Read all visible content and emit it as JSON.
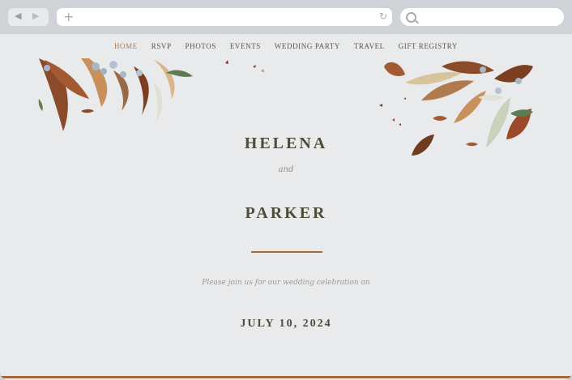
{
  "browser": {
    "back_icon": "back-arrow-icon",
    "forward_icon": "forward-arrow-icon",
    "address_placeholder": "",
    "search_placeholder": ""
  },
  "nav": {
    "items": [
      {
        "label": "HOME"
      },
      {
        "label": "RSVP"
      },
      {
        "label": "PHOTOS"
      },
      {
        "label": "EVENTS"
      },
      {
        "label": "WEDDING PARTY"
      },
      {
        "label": "TRAVEL"
      },
      {
        "label": "GIFT REGISTRY"
      }
    ],
    "active_color": "#b07a4f"
  },
  "hero": {
    "name1": "HELENA",
    "and": "and",
    "name2": "PARKER",
    "invite": "Please join us for our wedding celebration on",
    "date": "JULY 10, 2024",
    "accent_color": "#a16a3f",
    "text_color": "#4b4e39"
  }
}
